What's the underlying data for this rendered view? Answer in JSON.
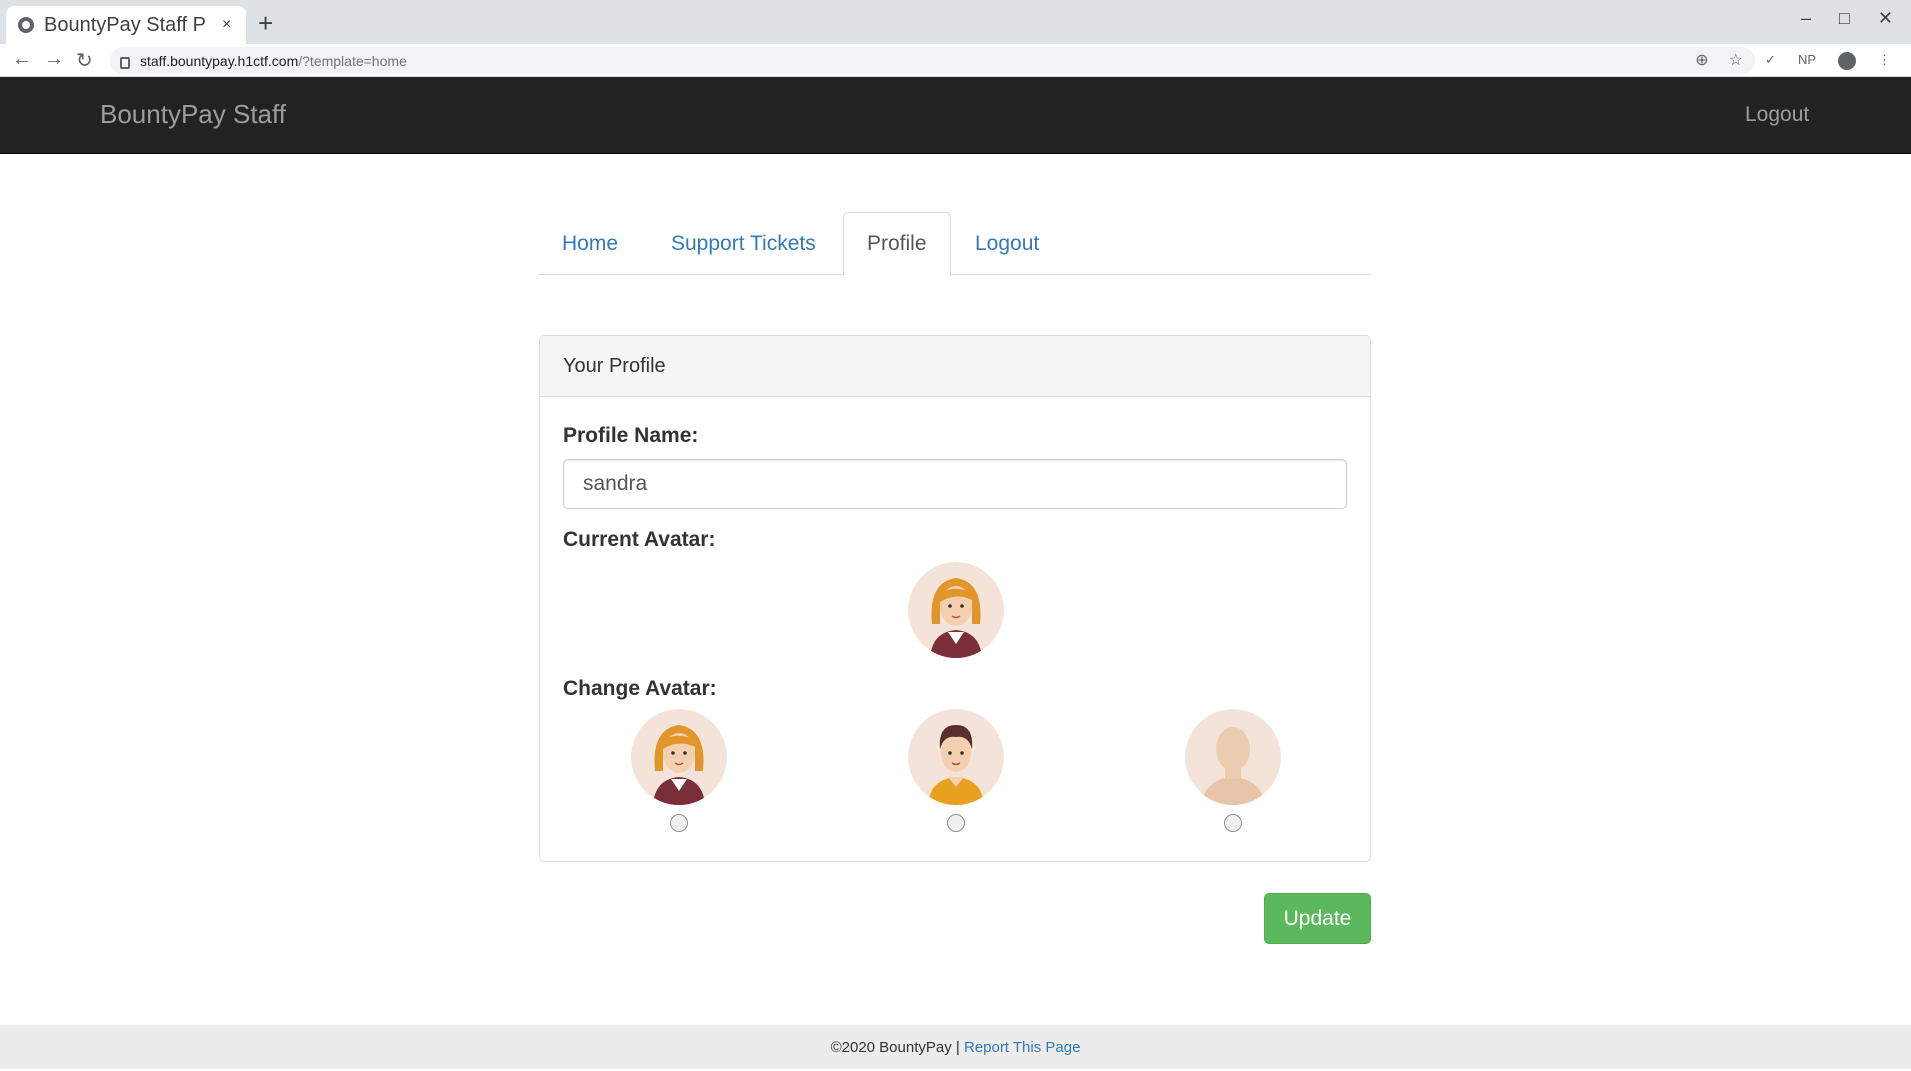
{
  "browser": {
    "tab_title": "BountyPay Staff P",
    "tab_close": "×",
    "new_tab": "+",
    "url_host": "staff.bountypay.h1ctf.com",
    "url_path": "/?template=home",
    "ext_np": "NP",
    "window_min": "–",
    "window_max": "□",
    "window_close": "✕"
  },
  "navbar": {
    "brand": "BountyPay Staff",
    "logout": "Logout"
  },
  "tabs": [
    {
      "label": "Home",
      "active": false
    },
    {
      "label": "Support Tickets",
      "active": false
    },
    {
      "label": "Profile",
      "active": true
    },
    {
      "label": "Logout",
      "active": false
    }
  ],
  "profile": {
    "panel_title": "Your Profile",
    "name_label": "Profile Name:",
    "name_value": "sandra",
    "current_avatar_label": "Current Avatar:",
    "change_avatar_label": "Change Avatar:",
    "update_label": "Update"
  },
  "footer": {
    "copyright": "©2020 BountyPay |",
    "report_link": "Report This Page"
  },
  "colors": {
    "navbar_bg": "#222222",
    "link": "#337ab7",
    "success": "#5cb85c",
    "footer_bg": "#ececec"
  }
}
